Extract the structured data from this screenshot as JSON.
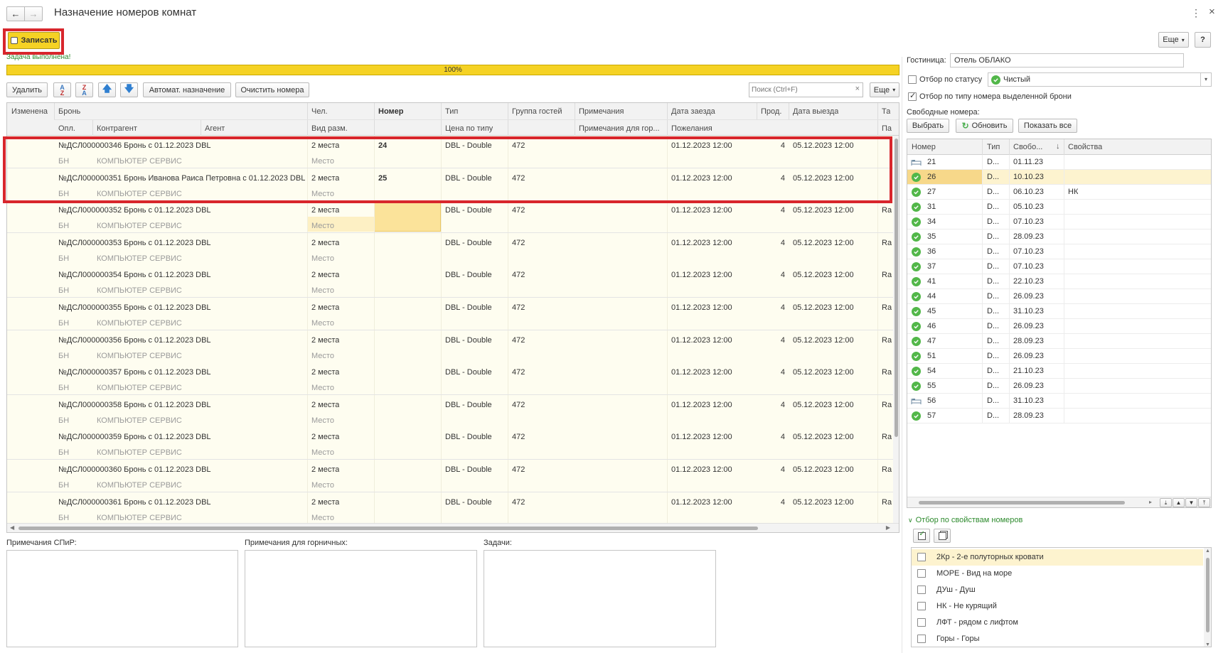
{
  "window": {
    "title": "Назначение номеров комнат"
  },
  "toolbar": {
    "save_label": "Записать",
    "more_label": "Еще",
    "help_label": "?"
  },
  "progress": {
    "status": "Задача выполнена!",
    "percent_label": "100%",
    "value": 1.0
  },
  "grid_toolbar": {
    "delete_label": "Удалить",
    "auto_assign_label": "Автомат. назначение",
    "clear_rooms_label": "Очистить номера",
    "search_placeholder": "Поиск (Ctrl+F)",
    "more_label": "Еще"
  },
  "grid": {
    "headers1": [
      "Изменена",
      "Бронь",
      "Чел.",
      "Номер",
      "Тип",
      "Группа гостей",
      "Примечания",
      "Дата заезда",
      "Прод.",
      "Дата выезда",
      "Та"
    ],
    "headers2": [
      "Опл.",
      "Контрагент",
      "Агент",
      "Вид разм.",
      "Цена по типу",
      "Примечания для гор...",
      "Пожелания",
      "Па"
    ],
    "rows": [
      {
        "bron": "№ДСЛ000000346 Бронь с 01.12.2023 DBL",
        "chel": "2 места",
        "nomer": "24",
        "tip": "DBL - Double",
        "gruppa": "472",
        "zaezd": "01.12.2023 12:00",
        "prod": "4",
        "vyezd": "05.12.2023 12:00",
        "ta": "",
        "opl": "БН",
        "kontr": "КОМПЬЮТЕР СЕРВИС",
        "vid": "Место"
      },
      {
        "bron": "№ДСЛ000000351 Бронь Иванова Раиса Петровна с 01.12.2023 DBL",
        "chel": "2 места",
        "nomer": "25",
        "tip": "DBL - Double",
        "gruppa": "472",
        "zaezd": "01.12.2023 12:00",
        "prod": "4",
        "vyezd": "05.12.2023 12:00",
        "ta": "",
        "opl": "БН",
        "kontr": "КОМПЬЮТЕР СЕРВИС",
        "vid": "Место"
      },
      {
        "bron": "№ДСЛ000000352 Бронь с 01.12.2023 DBL",
        "chel": "2 места",
        "nomer": "",
        "tip": "DBL - Double",
        "gruppa": "472",
        "zaezd": "01.12.2023 12:00",
        "prod": "4",
        "vyezd": "05.12.2023 12:00",
        "ta": "Ra",
        "opl": "БН",
        "kontr": "КОМПЬЮТЕР СЕРВИС",
        "vid": "Место"
      },
      {
        "bron": "№ДСЛ000000353 Бронь с 01.12.2023 DBL",
        "chel": "2 места",
        "nomer": "",
        "tip": "DBL - Double",
        "gruppa": "472",
        "zaezd": "01.12.2023 12:00",
        "prod": "4",
        "vyezd": "05.12.2023 12:00",
        "ta": "Ra",
        "opl": "БН",
        "kontr": "КОМПЬЮТЕР СЕРВИС",
        "vid": "Место"
      },
      {
        "bron": "№ДСЛ000000354 Бронь с 01.12.2023 DBL",
        "chel": "2 места",
        "nomer": "",
        "tip": "DBL - Double",
        "gruppa": "472",
        "zaezd": "01.12.2023 12:00",
        "prod": "4",
        "vyezd": "05.12.2023 12:00",
        "ta": "Ra",
        "opl": "БН",
        "kontr": "КОМПЬЮТЕР СЕРВИС",
        "vid": "Место"
      },
      {
        "bron": "№ДСЛ000000355 Бронь с 01.12.2023 DBL",
        "chel": "2 места",
        "nomer": "",
        "tip": "DBL - Double",
        "gruppa": "472",
        "zaezd": "01.12.2023 12:00",
        "prod": "4",
        "vyezd": "05.12.2023 12:00",
        "ta": "Ra",
        "opl": "БН",
        "kontr": "КОМПЬЮТЕР СЕРВИС",
        "vid": "Место"
      },
      {
        "bron": "№ДСЛ000000356 Бронь с 01.12.2023 DBL",
        "chel": "2 места",
        "nomer": "",
        "tip": "DBL - Double",
        "gruppa": "472",
        "zaezd": "01.12.2023 12:00",
        "prod": "4",
        "vyezd": "05.12.2023 12:00",
        "ta": "Ra",
        "opl": "БН",
        "kontr": "КОМПЬЮТЕР СЕРВИС",
        "vid": "Место"
      },
      {
        "bron": "№ДСЛ000000357 Бронь с 01.12.2023 DBL",
        "chel": "2 места",
        "nomer": "",
        "tip": "DBL - Double",
        "gruppa": "472",
        "zaezd": "01.12.2023 12:00",
        "prod": "4",
        "vyezd": "05.12.2023 12:00",
        "ta": "Ra",
        "opl": "БН",
        "kontr": "КОМПЬЮТЕР СЕРВИС",
        "vid": "Место"
      },
      {
        "bron": "№ДСЛ000000358 Бронь с 01.12.2023 DBL",
        "chel": "2 места",
        "nomer": "",
        "tip": "DBL - Double",
        "gruppa": "472",
        "zaezd": "01.12.2023 12:00",
        "prod": "4",
        "vyezd": "05.12.2023 12:00",
        "ta": "Ra",
        "opl": "БН",
        "kontr": "КОМПЬЮТЕР СЕРВИС",
        "vid": "Место"
      },
      {
        "bron": "№ДСЛ000000359 Бронь с 01.12.2023 DBL",
        "chel": "2 места",
        "nomer": "",
        "tip": "DBL - Double",
        "gruppa": "472",
        "zaezd": "01.12.2023 12:00",
        "prod": "4",
        "vyezd": "05.12.2023 12:00",
        "ta": "Ra",
        "opl": "БН",
        "kontr": "КОМПЬЮТЕР СЕРВИС",
        "vid": "Место"
      },
      {
        "bron": "№ДСЛ000000360 Бронь с 01.12.2023 DBL",
        "chel": "2 места",
        "nomer": "",
        "tip": "DBL - Double",
        "gruppa": "472",
        "zaezd": "01.12.2023 12:00",
        "prod": "4",
        "vyezd": "05.12.2023 12:00",
        "ta": "Ra",
        "opl": "БН",
        "kontr": "КОМПЬЮТЕР СЕРВИС",
        "vid": "Место"
      },
      {
        "bron": "№ДСЛ000000361 Бронь с 01.12.2023 DBL",
        "chel": "2 места",
        "nomer": "",
        "tip": "DBL - Double",
        "gruppa": "472",
        "zaezd": "01.12.2023 12:00",
        "prod": "4",
        "vyezd": "05.12.2023 12:00",
        "ta": "Ra",
        "opl": "БН",
        "kontr": "КОМПЬЮТЕР СЕРВИС",
        "vid": "Место"
      }
    ]
  },
  "notes": {
    "spir_label": "Примечания СПиР:",
    "maids_label": "Примечания для горничных:",
    "tasks_label": "Задачи:"
  },
  "right": {
    "hotel_label": "Гостиница:",
    "hotel_value": "Отель ОБЛАКО",
    "status_filter_label": "Отбор по статусу",
    "status_value": "Чистый",
    "type_filter_label": "Отбор по типу номера выделенной брони",
    "free_label": "Свободные номера:",
    "select_label": "Выбрать",
    "refresh_label": "Обновить",
    "show_all_label": "Показать все",
    "rooms_headers": [
      "Номер",
      "Тип",
      "Свобо...",
      "Свойства"
    ],
    "rooms": [
      {
        "num": "21",
        "type": "D...",
        "free": "01.11.23",
        "props": "",
        "icon": "bed-icon"
      },
      {
        "num": "26",
        "type": "D...",
        "free": "10.10.23",
        "props": "",
        "icon": "check-icon"
      },
      {
        "num": "27",
        "type": "D...",
        "free": "06.10.23",
        "props": "НК",
        "icon": "check-icon"
      },
      {
        "num": "31",
        "type": "D...",
        "free": "05.10.23",
        "props": "",
        "icon": "check-icon"
      },
      {
        "num": "34",
        "type": "D...",
        "free": "07.10.23",
        "props": "",
        "icon": "check-icon"
      },
      {
        "num": "35",
        "type": "D...",
        "free": "28.09.23",
        "props": "",
        "icon": "check-icon"
      },
      {
        "num": "36",
        "type": "D...",
        "free": "07.10.23",
        "props": "",
        "icon": "check-icon"
      },
      {
        "num": "37",
        "type": "D...",
        "free": "07.10.23",
        "props": "",
        "icon": "check-icon"
      },
      {
        "num": "41",
        "type": "D...",
        "free": "22.10.23",
        "props": "",
        "icon": "check-icon"
      },
      {
        "num": "44",
        "type": "D...",
        "free": "26.09.23",
        "props": "",
        "icon": "check-icon"
      },
      {
        "num": "45",
        "type": "D...",
        "free": "31.10.23",
        "props": "",
        "icon": "check-icon"
      },
      {
        "num": "46",
        "type": "D...",
        "free": "26.09.23",
        "props": "",
        "icon": "check-icon"
      },
      {
        "num": "47",
        "type": "D...",
        "free": "28.09.23",
        "props": "",
        "icon": "check-icon"
      },
      {
        "num": "51",
        "type": "D...",
        "free": "26.09.23",
        "props": "",
        "icon": "check-icon"
      },
      {
        "num": "54",
        "type": "D...",
        "free": "21.10.23",
        "props": "",
        "icon": "check-icon"
      },
      {
        "num": "55",
        "type": "D...",
        "free": "26.09.23",
        "props": "",
        "icon": "check-icon"
      },
      {
        "num": "56",
        "type": "D...",
        "free": "31.10.23",
        "props": "",
        "icon": "bed-icon"
      },
      {
        "num": "57",
        "type": "D...",
        "free": "28.09.23",
        "props": "",
        "icon": "check-icon"
      }
    ],
    "props_filter_label": "Отбор по свойствам номеров",
    "props": [
      "2Кр - 2-е полуторных кровати",
      "МОРЕ - Вид на море",
      "ДУш - Душ",
      "НК - Не курящий",
      "ЛФТ - рядом с лифтом",
      "Горы - Горы"
    ]
  }
}
